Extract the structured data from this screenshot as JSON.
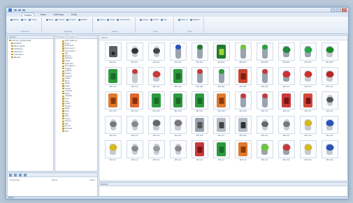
{
  "window": {
    "title": ""
  },
  "tabs": [
    "Home",
    "View",
    "Settings",
    "Help"
  ],
  "ribbon_groups": [
    {
      "label": "Clipboard",
      "buttons": [
        "Paste",
        "Cut",
        "Copy"
      ]
    },
    {
      "label": "Organize",
      "buttons": [
        "New",
        "Import",
        "Export",
        "Delete"
      ]
    },
    {
      "label": "Library",
      "buttons": [
        "Open",
        "Save",
        "Properties"
      ]
    },
    {
      "label": "View",
      "buttons": [
        "Large",
        "Small",
        "List"
      ]
    },
    {
      "label": "Tools",
      "buttons": [
        "Search",
        "Options"
      ]
    }
  ],
  "tree": {
    "header": "Library",
    "items": [
      {
        "label": "Library_Symbols.lib",
        "level": 0
      },
      {
        "label": "Buttons",
        "level": 1
      },
      {
        "label": "Pilot Lights",
        "level": 1
      },
      {
        "label": "Switches",
        "level": 1
      },
      {
        "label": "Selectors",
        "level": 1
      },
      {
        "label": "Indicators",
        "level": 1
      },
      {
        "label": "Panels",
        "level": 1
      }
    ]
  },
  "folders": {
    "tabs": [
      "Folders",
      "Search"
    ],
    "items": [
      "Push Buttons",
      "Flush",
      "Extended",
      "Mushroom",
      "Illuminated",
      "Key",
      "Rotary",
      "Selector",
      "Lamp",
      "Push-Pull",
      "Emergency",
      "Toggle",
      "Joystick",
      "Buzzer",
      "Legend",
      "Guard",
      "Boot",
      "Bezel",
      "Label",
      "Holder",
      "Contact",
      "Block",
      "Adapter",
      "Lens",
      "Cap",
      "Insert",
      "Frame",
      "Plate",
      "Ring",
      "Nut",
      "Seal",
      "Cover",
      "Spacer",
      "Clip",
      "Mount",
      "Bracket",
      "Misc"
    ]
  },
  "gallery": {
    "header": "Items",
    "rows": [
      [
        {
          "label": "ZB4 BA2",
          "body": "#5b5f66",
          "cap": "#222222",
          "style": "box"
        },
        {
          "label": "ZB4 BA3",
          "body": "#c7cbd1",
          "cap": "#333333",
          "style": "knob"
        },
        {
          "label": "ZB4 BA4",
          "body": "#c7cbd1",
          "cap": "#444444",
          "style": "knob"
        },
        {
          "label": "ZB4 BA5",
          "body": "#9aa4b0",
          "cap": "#2a53b8",
          "style": "tall"
        },
        {
          "label": "ZB4 BA6",
          "body": "#9aa4b0",
          "cap": "#1f7a2e",
          "style": "tall"
        },
        {
          "label": "ZB4 BW3",
          "body": "#1f7a2e",
          "cap": "#9bd53a",
          "style": "panel"
        },
        {
          "label": "ZB4 BW4",
          "body": "#9aa4b0",
          "cap": "#6ec63a",
          "style": "tall"
        },
        {
          "label": "ZB4 BW5",
          "body": "#9aa4b0",
          "cap": "#2e9d3f",
          "style": "tall"
        },
        {
          "label": "ZB4 BW6",
          "body": "#9aa4b0",
          "cap": "#1e8a3a",
          "style": "round"
        },
        {
          "label": "ZB4 BW7",
          "body": "#9aa4b0",
          "cap": "#26a64a",
          "style": "round"
        },
        {
          "label": "ZB4 BW8",
          "body": "#c7cbd1",
          "cap": "#1b8a2c",
          "style": "round"
        }
      ],
      [
        {
          "label": "ZB5 AA3",
          "body": "#2d9b3e",
          "cap": "#1a6b29",
          "style": "panel"
        },
        {
          "label": "ZB5 AA4",
          "body": "#c7cbd1",
          "cap": "#c83a3a",
          "style": "tall"
        },
        {
          "label": "ZB5 AA5",
          "body": "#c7cbd1",
          "cap": "#c83a3a",
          "style": "round"
        },
        {
          "label": "ZB5 AA6",
          "body": "#2d9b3e",
          "cap": "#1a6b29",
          "style": "panel"
        },
        {
          "label": "ZB5 AB3",
          "body": "#9aa4b0",
          "cap": "#c83a3a",
          "style": "tall"
        },
        {
          "label": "ZB5 AB4",
          "body": "#9aa4b0",
          "cap": "#2d9b3e",
          "style": "tall"
        },
        {
          "label": "ZB5 AB5",
          "body": "#c8462f",
          "cap": "#7d1f12",
          "style": "panel"
        },
        {
          "label": "ZB5 AB6",
          "body": "#9aa4b0",
          "cap": "#c83a3a",
          "style": "tall"
        },
        {
          "label": "ZB5 AC2",
          "body": "#9aa4b0",
          "cap": "#d03030",
          "style": "round"
        },
        {
          "label": "ZB5 AC3",
          "body": "#c7cbd1",
          "cap": "#d03030",
          "style": "round"
        },
        {
          "label": "ZB5 AC4",
          "body": "#c7cbd1",
          "cap": "#b82424",
          "style": "round"
        }
      ],
      [
        {
          "label": "ZB5 AW3",
          "body": "#e07a2e",
          "cap": "#8a3b0c",
          "style": "panel"
        },
        {
          "label": "ZB5 AW4",
          "body": "#e0662e",
          "cap": "#8a2f0c",
          "style": "panel"
        },
        {
          "label": "ZB5 AW5",
          "body": "#2d9b3e",
          "cap": "#1a6b29",
          "style": "panel"
        },
        {
          "label": "ZB5 AW6",
          "body": "#2d9b3e",
          "cap": "#1a6b29",
          "style": "panel"
        },
        {
          "label": "ZB5 AW7",
          "body": "#2d9b3e",
          "cap": "#1a6b29",
          "style": "panel"
        },
        {
          "label": "ZB5 AW8",
          "body": "#e07a2e",
          "cap": "#8a3b0c",
          "style": "panel"
        },
        {
          "label": "ZB5 AW9",
          "body": "#9aa4b0",
          "cap": "#c83a3a",
          "style": "tall"
        },
        {
          "label": "ZB5 AV3",
          "body": "#9aa4b0",
          "cap": "#c83a3a",
          "style": "tall"
        },
        {
          "label": "ZB5 AV4",
          "body": "#c83a3a",
          "cap": "#7a1414",
          "style": "panel"
        },
        {
          "label": "ZB5 AV5",
          "body": "#d14a3a",
          "cap": "#7a1414",
          "style": "panel"
        },
        {
          "label": "ZB5 AV6",
          "body": "#c7cbd1",
          "cap": "#555555",
          "style": "knob"
        }
      ],
      [
        {
          "label": "ZB5 AD2",
          "body": "#c7cbd1",
          "cap": "#777777",
          "style": "knob"
        },
        {
          "label": "ZB5 AD3",
          "body": "#c7cbd1",
          "cap": "#888888",
          "style": "knob"
        },
        {
          "label": "ZB5 AD4",
          "body": "#c7cbd1",
          "cap": "#666666",
          "style": "round"
        },
        {
          "label": "ZB5 AD5",
          "body": "#c7cbd1",
          "cap": "#777777",
          "style": "round"
        },
        {
          "label": "ZB5 AD6",
          "body": "#9aa4b0",
          "cap": "#555555",
          "style": "panel"
        },
        {
          "label": "ZB5 AD7",
          "body": "#b7bdc6",
          "cap": "#444444",
          "style": "panel"
        },
        {
          "label": "ZB5 AD8",
          "body": "#b7bdc6",
          "cap": "#333333",
          "style": "panel"
        },
        {
          "label": "ZB5 AG2",
          "body": "#c7cbd1",
          "cap": "#666666",
          "style": "knob"
        },
        {
          "label": "ZB5 AG3",
          "body": "#c7cbd1",
          "cap": "#777777",
          "style": "knob"
        },
        {
          "label": "ZB5 AG4",
          "body": "#c7cbd1",
          "cap": "#d6b820",
          "style": "round"
        },
        {
          "label": "ZB5 AG5",
          "body": "#c7cbd1",
          "cap": "#2a53b8",
          "style": "round"
        }
      ],
      [
        {
          "label": "ZB5 AL2",
          "body": "#c7cbd1",
          "cap": "#d6b820",
          "style": "round"
        },
        {
          "label": "ZB5 AL3",
          "body": "#c7cbd1",
          "cap": "#888888",
          "style": "knob"
        },
        {
          "label": "ZB5 AL4",
          "body": "#c7cbd1",
          "cap": "#999999",
          "style": "knob"
        },
        {
          "label": "ZB5 AL5",
          "body": "#c7cbd1",
          "cap": "#888888",
          "style": "knob"
        },
        {
          "label": "ZB5 AL6",
          "body": "#c83a3a",
          "cap": "#7a1414",
          "style": "panel"
        },
        {
          "label": "ZB5 AL7",
          "body": "#2d9b3e",
          "cap": "#1a6b29",
          "style": "panel"
        },
        {
          "label": "ZB5 AL8",
          "body": "#e07a2e",
          "cap": "#8a3b0c",
          "style": "panel"
        },
        {
          "label": "ZB5 AL9",
          "body": "#9aa4b0",
          "cap": "#6ec63a",
          "style": "round"
        },
        {
          "label": "ZB5 AM2",
          "body": "#9aa4b0",
          "cap": "#c83a3a",
          "style": "round"
        },
        {
          "label": "ZB5 AM3",
          "body": "#c7cbd1",
          "cap": "#d6b820",
          "style": "round"
        },
        {
          "label": "ZB5 AM4",
          "body": "#c7cbd1",
          "cap": "#2a53b8",
          "style": "round"
        }
      ]
    ]
  },
  "bottom_left": {
    "left_text": "Properties",
    "mid_text": "Name",
    "right_text": "Value"
  },
  "bottom_right": {
    "header": "Details"
  },
  "status": {
    "text": "Ready"
  }
}
